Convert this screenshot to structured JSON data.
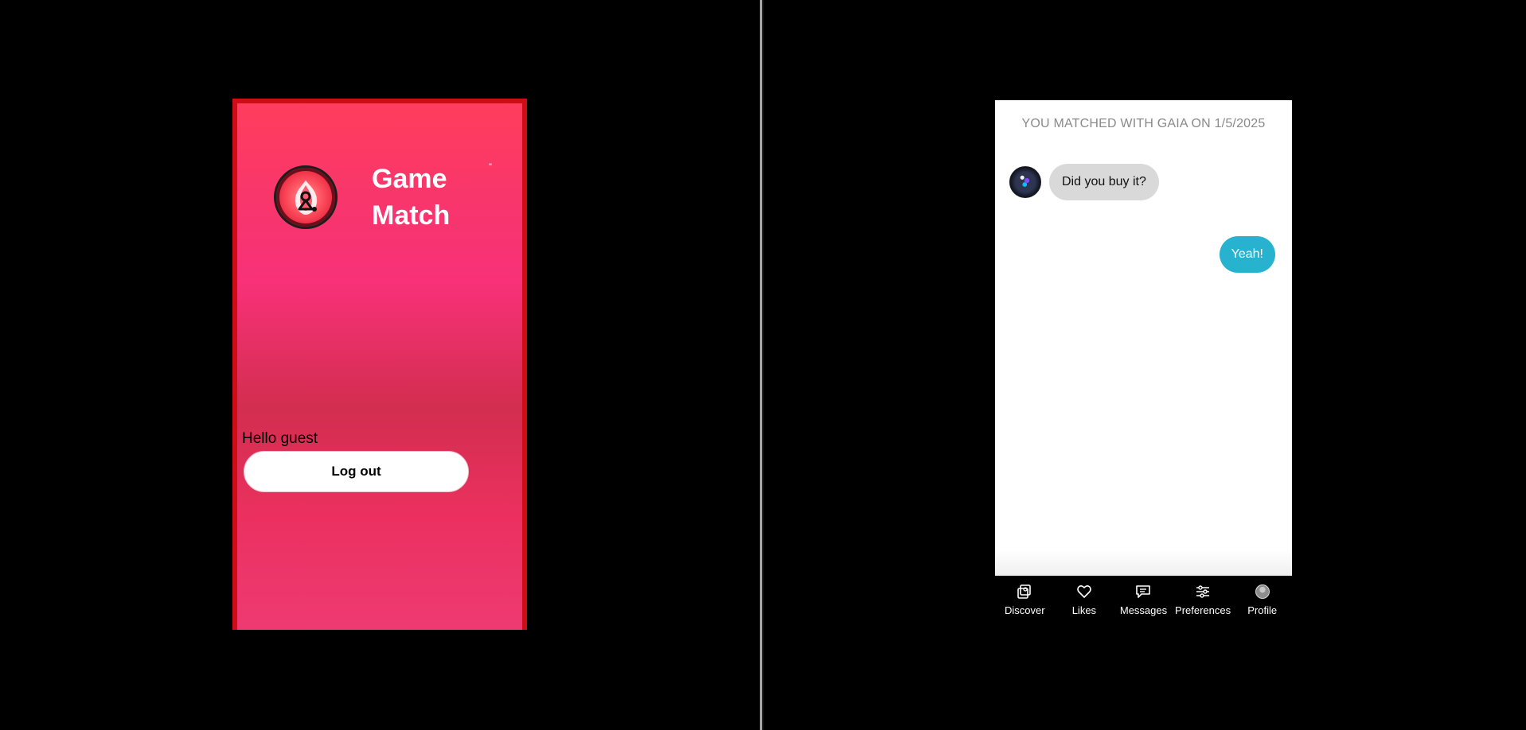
{
  "left": {
    "app_title_line1": "Game",
    "app_title_line2": "Match",
    "tiny_mark": "\"",
    "hello_text": "Hello guest",
    "logout_label": "Log out"
  },
  "right": {
    "match_header": "YOU MATCHED WITH GAIA ON 1/5/2025",
    "messages": [
      {
        "side": "received",
        "text": "Did you buy it?"
      },
      {
        "side": "sent",
        "text": "Yeah!"
      }
    ],
    "nav": [
      {
        "label": "Discover",
        "icon": "discover-icon"
      },
      {
        "label": "Likes",
        "icon": "heart-icon"
      },
      {
        "label": "Messages",
        "icon": "message-icon"
      },
      {
        "label": "Preferences",
        "icon": "sliders-icon"
      },
      {
        "label": "Profile",
        "icon": "avatar-icon"
      }
    ]
  },
  "colors": {
    "background": "#000000",
    "left_card_border": "#cf0d17",
    "left_gradient_top": "#ff3d5d",
    "left_gradient_mid": "#f83178",
    "left_gradient_low": "#d22e4f",
    "sent_bubble": "#27b3cf",
    "received_bubble": "#d9d9d9",
    "chat_header_text": "#8a8a8a"
  }
}
